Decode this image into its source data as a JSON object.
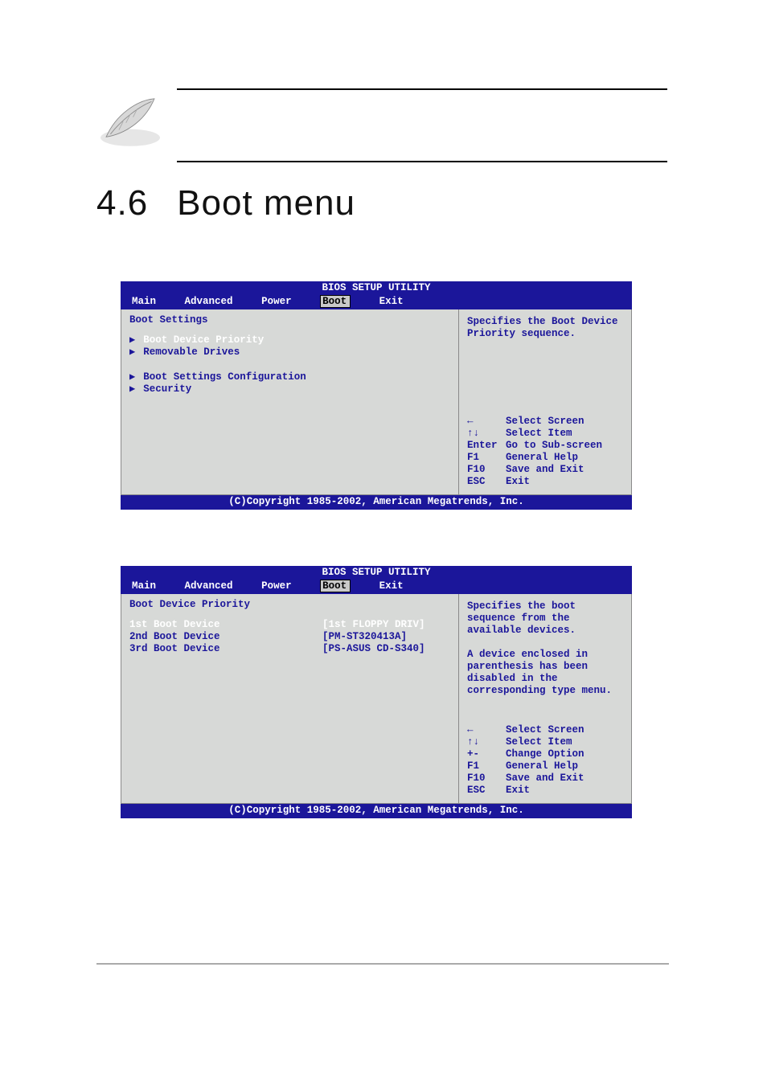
{
  "heading": {
    "number": "4.6",
    "title": "Boot menu"
  },
  "bios1": {
    "title": "BIOS SETUP UTILITY",
    "menu": [
      "Main",
      "Advanced",
      "Power",
      "Boot",
      "Exit"
    ],
    "active_menu": "Boot",
    "section_label": "Boot Settings",
    "items": [
      "Boot Device Priority",
      "Removable Drives",
      "Boot Settings Configuration",
      "Security"
    ],
    "help_text": "Specifies the Boot Device Priority sequence.",
    "keys": [
      {
        "k": "←",
        "d": "Select Screen",
        "icon": "arrow-left-icon"
      },
      {
        "k": "↑↓",
        "d": "Select Item",
        "icon": "arrows-up-down-icon"
      },
      {
        "k": "Enter",
        "d": "Go to Sub-screen"
      },
      {
        "k": "F1",
        "d": "General Help"
      },
      {
        "k": "F10",
        "d": "Save and Exit"
      },
      {
        "k": "ESC",
        "d": "Exit"
      }
    ],
    "copyright": "(C)Copyright 1985-2002, American Megatrends, Inc."
  },
  "bios2": {
    "title": "BIOS SETUP UTILITY",
    "menu": [
      "Main",
      "Advanced",
      "Power",
      "Boot",
      "Exit"
    ],
    "active_menu": "Boot",
    "section_label": "Boot Device Priority",
    "rows": [
      {
        "label": "1st Boot Device",
        "value": "[1st FLOPPY DRIV]"
      },
      {
        "label": "2nd Boot Device",
        "value": "[PM-ST320413A]"
      },
      {
        "label": "3rd Boot Device",
        "value": "[PS-ASUS CD-S340]"
      }
    ],
    "help_text": "Specifies the boot sequence from the available devices.\n\nA device enclosed in parenthesis has been disabled in the corresponding type menu.",
    "keys": [
      {
        "k": "←",
        "d": "Select Screen",
        "icon": "arrow-left-icon"
      },
      {
        "k": "↑↓",
        "d": "Select Item",
        "icon": "arrows-up-down-icon"
      },
      {
        "k": "+-",
        "d": "Change Option"
      },
      {
        "k": "F1",
        "d": "General Help"
      },
      {
        "k": "F10",
        "d": "Save and Exit"
      },
      {
        "k": "ESC",
        "d": "Exit"
      }
    ],
    "copyright": "(C)Copyright 1985-2002, American Megatrends, Inc."
  }
}
